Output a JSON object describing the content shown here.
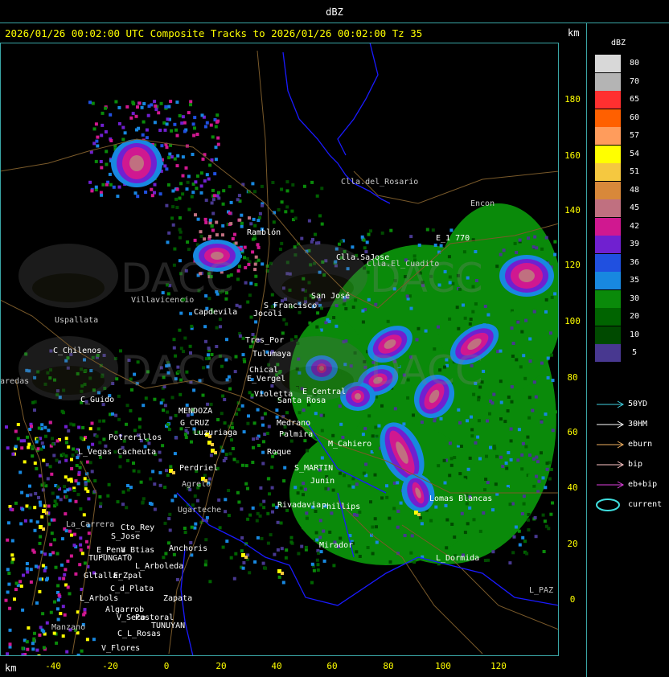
{
  "header": {
    "title": "dBZ",
    "subtitle": "2026/01/26 00:02:00 UTC Composite Tracks to 2026/01/26 00:02:00 Tz 35",
    "km_top": "km",
    "km_bottom": "km"
  },
  "axes": {
    "y_ticks": [
      "180",
      "160",
      "140",
      "120",
      "100",
      "80",
      "60",
      "40",
      "20",
      "0"
    ],
    "x_ticks": [
      "-40",
      "-20",
      "0",
      "20",
      "40",
      "60",
      "80",
      "100",
      "120"
    ]
  },
  "legend": {
    "title": "dBZ",
    "levels": [
      {
        "label": "80",
        "color": "#d8d8d8"
      },
      {
        "label": "70",
        "color": "#b4b4b4"
      },
      {
        "label": "65",
        "color": "#ff3030"
      },
      {
        "label": "60",
        "color": "#ff6000"
      },
      {
        "label": "57",
        "color": "#ff9c5c"
      },
      {
        "label": "54",
        "color": "#ffff00"
      },
      {
        "label": "51",
        "color": "#f5c840"
      },
      {
        "label": "48",
        "color": "#d8883a"
      },
      {
        "label": "45",
        "color": "#c07080"
      },
      {
        "label": "42",
        "color": "#d01890"
      },
      {
        "label": "39",
        "color": "#7020d0"
      },
      {
        "label": "36",
        "color": "#2050e0"
      },
      {
        "label": "35",
        "color": "#1888e0"
      },
      {
        "label": "30",
        "color": "#0a8a0a"
      },
      {
        "label": "20",
        "color": "#006400"
      },
      {
        "label": "10",
        "color": "#004a00"
      },
      {
        "label": "5",
        "color": "#483890"
      }
    ],
    "tracks": [
      {
        "label": "50YD",
        "color": "#40d0e0"
      },
      {
        "label": "30HM",
        "color": "#ffffff"
      },
      {
        "label": "eburn",
        "color": "#f0b060"
      },
      {
        "label": "bip",
        "color": "#ffc8c8"
      },
      {
        "label": "eb+bip",
        "color": "#e040e0"
      }
    ],
    "current": {
      "label": "current",
      "color": "#40e0e0"
    }
  },
  "places": [
    {
      "name": "Clla.del_Rosario"
    },
    {
      "name": "Encon"
    },
    {
      "name": "Ramblón"
    },
    {
      "name": "E_1 770"
    },
    {
      "name": "Clla.SaJose"
    },
    {
      "name": "Clla.El_Cuadito"
    },
    {
      "name": "Villavicencio"
    },
    {
      "name": "Uspallata"
    },
    {
      "name": "Capdevila"
    },
    {
      "name": "S_Francisco"
    },
    {
      "name": "Jocoli"
    },
    {
      "name": "San José"
    },
    {
      "name": "C_Chilenos"
    },
    {
      "name": "Tres_Por"
    },
    {
      "name": "Tulumaya"
    },
    {
      "name": "aredas"
    },
    {
      "name": "Chical"
    },
    {
      "name": "C_Guido"
    },
    {
      "name": "E_Vergel"
    },
    {
      "name": "Violetta"
    },
    {
      "name": "E_Central"
    },
    {
      "name": "MENDOZA"
    },
    {
      "name": "G_CRUZ"
    },
    {
      "name": "Luzuriaga"
    },
    {
      "name": "Potrerillos"
    },
    {
      "name": "L_Vegas"
    },
    {
      "name": "Cacheuta"
    },
    {
      "name": "Perdriel"
    },
    {
      "name": "Agrelo"
    },
    {
      "name": "Ugarteche"
    },
    {
      "name": "Roque"
    },
    {
      "name": "Palmira"
    },
    {
      "name": "Medrano"
    },
    {
      "name": "M_Cahiero"
    },
    {
      "name": "S_MARTIN"
    },
    {
      "name": "Junin"
    },
    {
      "name": "Rivadavia"
    },
    {
      "name": "Phillips"
    },
    {
      "name": "Lomas Blancas"
    },
    {
      "name": "La_Carrera"
    },
    {
      "name": "Cto_Rey"
    },
    {
      "name": "S_Jose"
    },
    {
      "name": "E_Pena"
    },
    {
      "name": "V_Btias"
    },
    {
      "name": "Anchoris"
    },
    {
      "name": "TUPUNGATO"
    },
    {
      "name": "L_Arboleda"
    },
    {
      "name": "Gltallar"
    },
    {
      "name": "E_Zpal"
    },
    {
      "name": "C_d_Plata"
    },
    {
      "name": "L_Arbols"
    },
    {
      "name": "Zapata"
    },
    {
      "name": "Algarrob"
    },
    {
      "name": "V_Seco"
    },
    {
      "name": "Pastoral"
    },
    {
      "name": "TUNUYAN"
    },
    {
      "name": "C_L_Rosas"
    },
    {
      "name": "Manzano"
    },
    {
      "name": "V_Flores"
    },
    {
      "name": "Mirador"
    },
    {
      "name": "L_Dormida"
    },
    {
      "name": "L_PAZ"
    },
    {
      "name": "Santa Rosa"
    }
  ],
  "watermark": {
    "text": "DACC"
  },
  "colors": {
    "frame": "#3aa6a6",
    "axis_text": "#ffff00",
    "province_border": "#1a1aff",
    "roads": "#7a5a2a"
  }
}
